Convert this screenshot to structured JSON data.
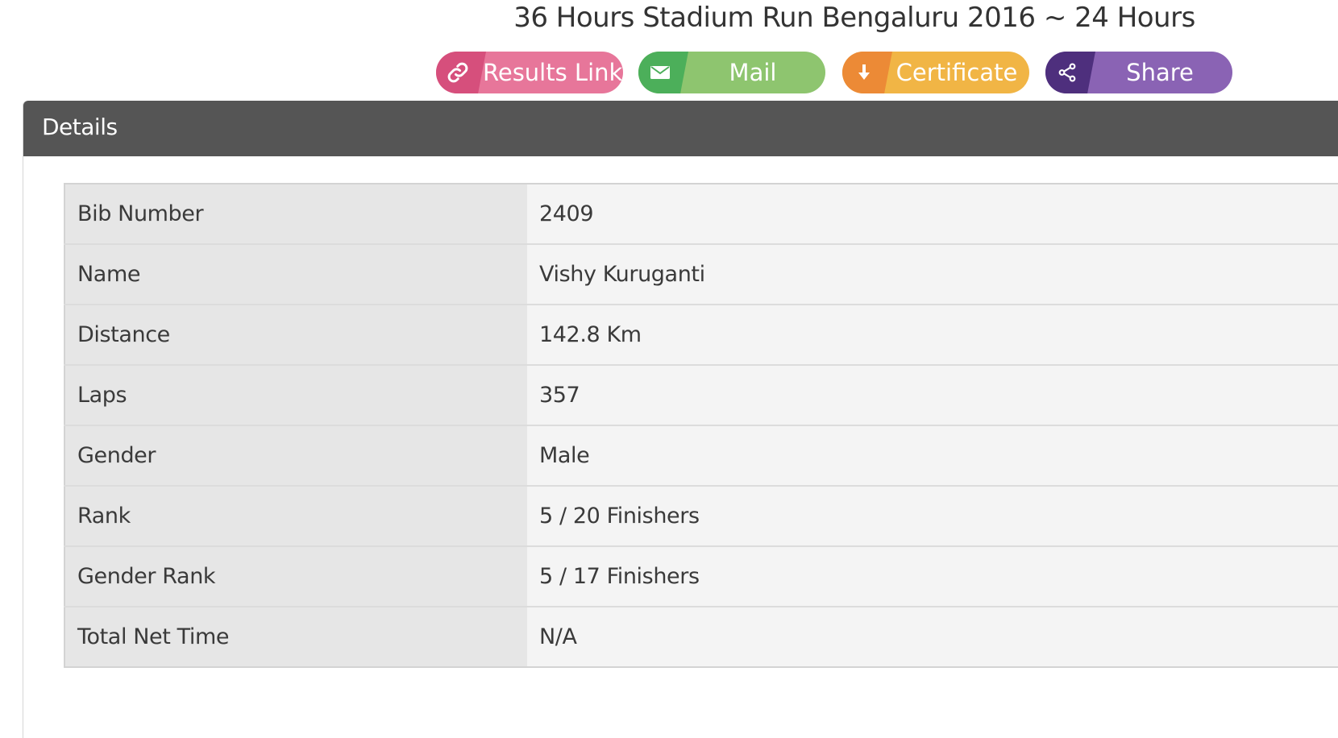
{
  "event": {
    "title": "36 Hours Stadium Run Bengaluru 2016 ~ 24 Hours"
  },
  "actions": {
    "results_link": {
      "label": "Results Link",
      "icon": "link-icon",
      "color": "#e7769a",
      "icon_color": "#d64f7c"
    },
    "mail": {
      "label": "Mail",
      "icon": "mail-icon",
      "color": "#8ec56f",
      "icon_color": "#4caf5a"
    },
    "certificate": {
      "label": "Certificate",
      "icon": "download-arrow-icon",
      "color": "#f1b545",
      "icon_color": "#ec8a36"
    },
    "share": {
      "label": "Share",
      "icon": "share-icon",
      "color": "#8a63b4",
      "icon_color": "#4e2f7d"
    }
  },
  "panel": {
    "title": "Details",
    "header_color": "#555555"
  },
  "details": {
    "rows": [
      {
        "key": "Bib Number",
        "value": "2409"
      },
      {
        "key": "Name",
        "value": "Vishy Kuruganti"
      },
      {
        "key": "Distance",
        "value": "142.8 Km"
      },
      {
        "key": "Laps",
        "value": "357"
      },
      {
        "key": "Gender",
        "value": "Male"
      },
      {
        "key": "Rank",
        "value": "5 / 20 Finishers"
      },
      {
        "key": "Gender Rank",
        "value": "5 / 17 Finishers"
      },
      {
        "key": "Total Net Time",
        "value": "N/A"
      }
    ]
  }
}
